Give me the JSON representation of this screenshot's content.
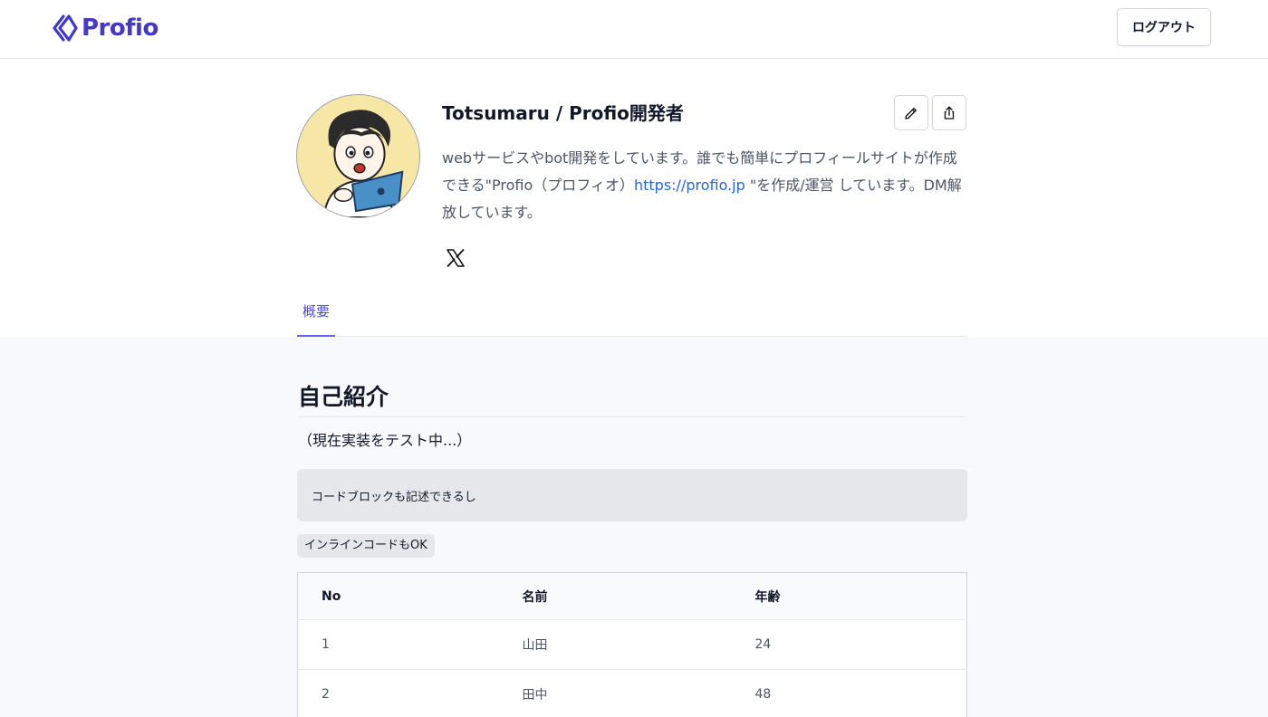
{
  "header": {
    "logo_text": "Profio",
    "logout_label": "ログアウト",
    "brand_color": "#4338ca"
  },
  "profile": {
    "name": "Totsumaru / Profio開発者",
    "bio_part1": "webサービスやbot開発をしています。誰でも簡単にプロフィールサイトが作成できる\"Profio（プロフィオ）",
    "bio_link": "https://profio.jp",
    "bio_part2": " \"を作成/運営 しています。DM解放しています。",
    "social": [
      "x-icon"
    ]
  },
  "tabs": [
    {
      "label": "概要",
      "active": true
    }
  ],
  "main": {
    "section_title": "自己紹介",
    "lead": "（現在実装をテスト中...）",
    "code_block": "コードブロックも記述できるし",
    "inline_code": "インラインコードもOK",
    "table": {
      "headers": [
        "No",
        "名前",
        "年齢"
      ],
      "rows": [
        [
          "1",
          "山田",
          "24"
        ],
        [
          "2",
          "田中",
          "48"
        ]
      ]
    }
  }
}
